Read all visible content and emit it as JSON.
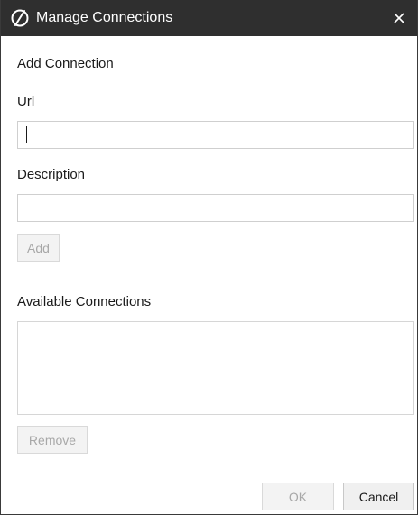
{
  "window": {
    "title": "Manage Connections",
    "icon": "app-logo-icon",
    "close_icon": "close-icon"
  },
  "form": {
    "section_title": "Add Connection",
    "url": {
      "label": "Url",
      "value": "",
      "placeholder": ""
    },
    "description": {
      "label": "Description",
      "value": "",
      "placeholder": ""
    },
    "add_label": "Add"
  },
  "connections": {
    "label": "Available Connections",
    "items": [],
    "remove_label": "Remove"
  },
  "footer": {
    "ok_label": "OK",
    "cancel_label": "Cancel"
  },
  "colors": {
    "titlebar": "#2f2f2f",
    "disabled_text": "#a8a8a8",
    "border": "#d6d6d6"
  }
}
